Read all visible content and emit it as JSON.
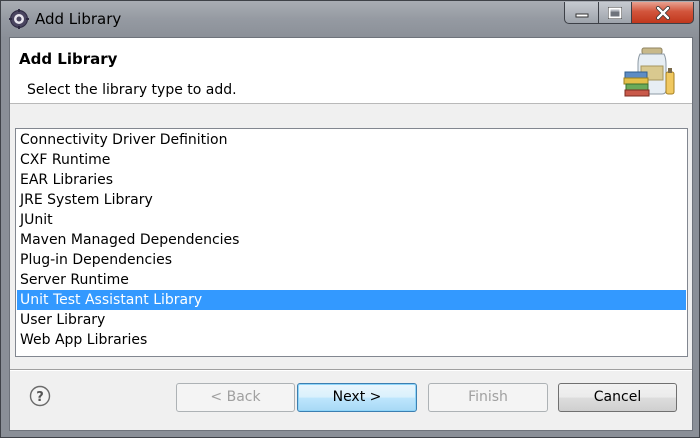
{
  "window": {
    "title": "Add Library",
    "app_icon": "eclipse-gear-icon",
    "controls": [
      "minimize-icon",
      "maximize-icon",
      "close-icon"
    ],
    "close_color": "#c7432a"
  },
  "banner": {
    "title": "Add Library",
    "description": "Select the library type to add.",
    "image": "library-jar-books-icon"
  },
  "library_types": {
    "items": [
      "Connectivity Driver Definition",
      "CXF Runtime",
      "EAR Libraries",
      "JRE System Library",
      "JUnit",
      "Maven Managed Dependencies",
      "Plug-in Dependencies",
      "Server Runtime",
      "Unit Test Assistant Library",
      "User Library",
      "Web App Libraries"
    ],
    "selected": "Unit Test Assistant Library",
    "selection_color": "#3399ff"
  },
  "footer": {
    "help_icon": "help-question-icon",
    "back_label": "< Back",
    "next_label": "Next >",
    "finish_label": "Finish",
    "cancel_label": "Cancel"
  }
}
